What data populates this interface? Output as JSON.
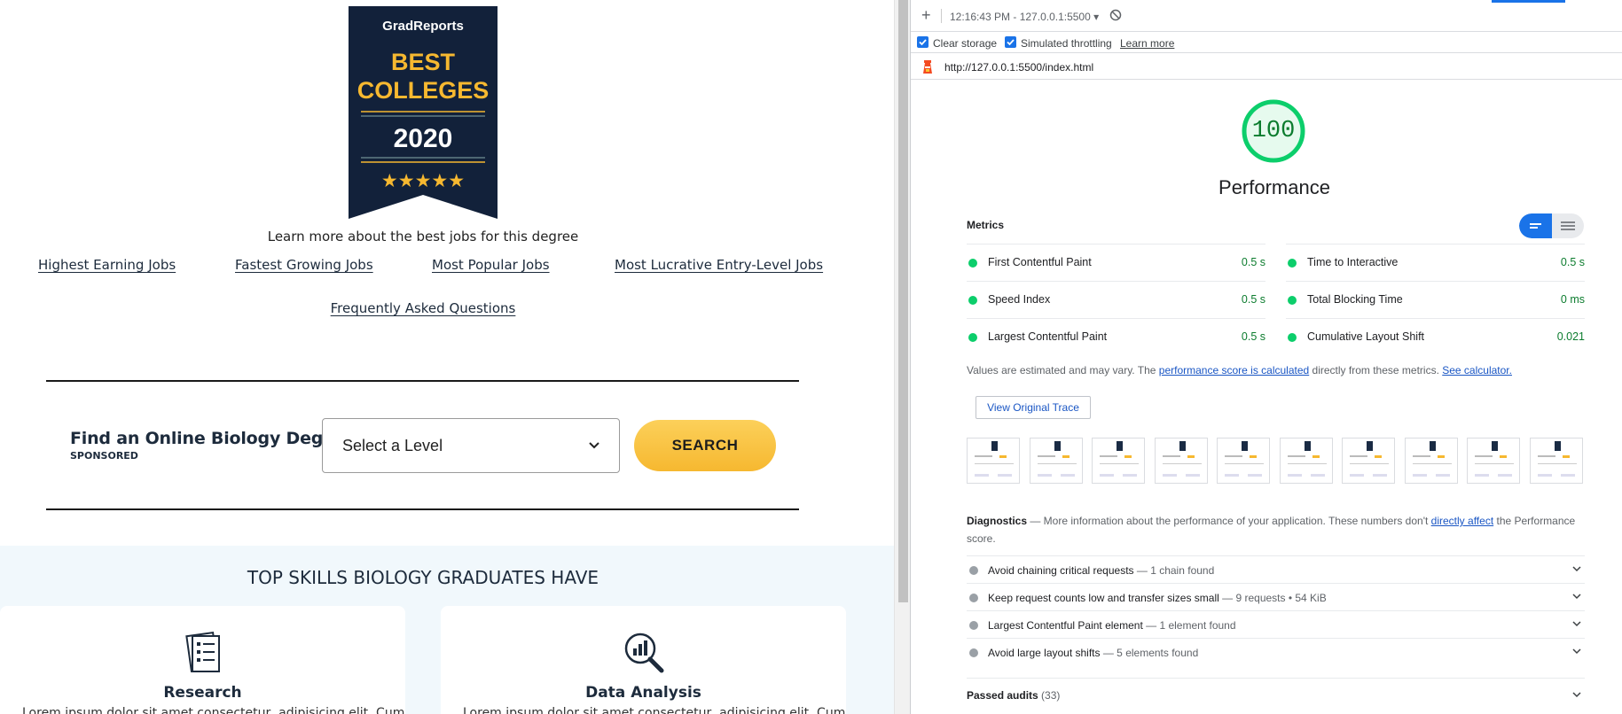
{
  "website": {
    "badge": {
      "brand": "GradReports",
      "line1": "BEST",
      "line2": "COLLEGES",
      "year": "2020",
      "stars": "★★★★★"
    },
    "learn_more_text": "Learn more about the best jobs for this degree",
    "job_links": [
      "Highest Earning Jobs",
      "Fastest Growing Jobs",
      "Most Popular Jobs",
      "Most Lucrative Entry-Level Jobs"
    ],
    "faq_link": "Frequently Asked Questions",
    "find_degree_label": "Find an Online Biology Degree:",
    "sponsored": "SPONSORED",
    "level_select": "Select a Level",
    "search_button": "SEARCH",
    "skills_title": "TOP SKILLS BIOLOGY GRADUATES HAVE",
    "skills": [
      {
        "icon": "research-document-icon",
        "name": "Research",
        "desc": "Lorem ipsum dolor sit amet consectetur, adipisicing elit. Cum"
      },
      {
        "icon": "data-analysis-icon",
        "name": "Data Analysis",
        "desc": "Lorem ipsum dolor sit amet consectetur, adipisicing elit. Cum"
      }
    ]
  },
  "lighthouse": {
    "run_label": "12:16:43 PM - 127.0.0.1:5500 ▾",
    "clear_storage": "Clear storage",
    "simulated_throttling": "Simulated throttling",
    "learn_more": "Learn more",
    "url": "http://127.0.0.1:5500/index.html",
    "score": "100",
    "score_value": 100,
    "category": "Performance",
    "metrics_header": "Metrics",
    "metrics": [
      {
        "name": "First Contentful Paint",
        "value": "0.5 s"
      },
      {
        "name": "Time to Interactive",
        "value": "0.5 s"
      },
      {
        "name": "Speed Index",
        "value": "0.5 s"
      },
      {
        "name": "Total Blocking Time",
        "value": "0 ms"
      },
      {
        "name": "Largest Contentful Paint",
        "value": "0.5 s"
      },
      {
        "name": "Cumulative Layout Shift",
        "value": "0.021"
      }
    ],
    "note_prefix": "Values are estimated and may vary. The ",
    "note_link1": "performance score is calculated",
    "note_mid": " directly from these metrics. ",
    "note_link2": "See calculator.",
    "view_trace": "View Original Trace",
    "diagnostics_title": "Diagnostics",
    "diagnostics_prefix": " — More information about the performance of your application. These numbers don't ",
    "diagnostics_link": "directly affect",
    "diagnostics_suffix": " the Performance score.",
    "audits": [
      {
        "title": "Avoid chaining critical requests",
        "detail": " — 1 chain found"
      },
      {
        "title": "Keep request counts low and transfer sizes small",
        "detail": " — 9 requests • 54 KiB"
      },
      {
        "title": "Largest Contentful Paint element",
        "detail": " — 1 element found"
      },
      {
        "title": "Avoid large layout shifts",
        "detail": " — 5 elements found"
      }
    ],
    "passed_label": "Passed audits",
    "passed_count": " (33)",
    "colors": {
      "pass": "#0cce6b",
      "accent": "#1a73e8",
      "neutral": "#9aa0a6"
    }
  }
}
